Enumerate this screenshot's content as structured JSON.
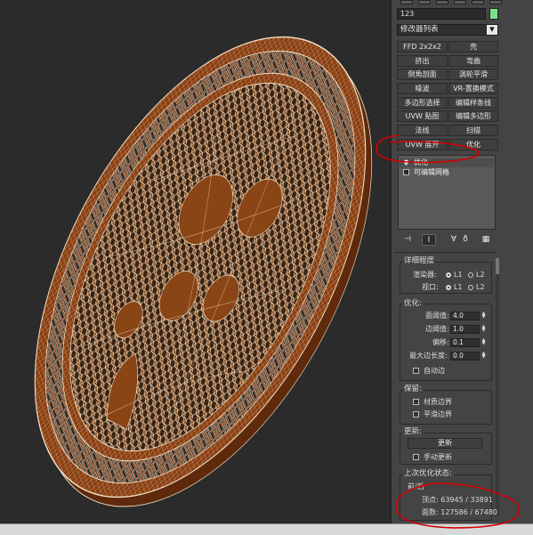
{
  "panel": {
    "object_name": "123",
    "object_color": "#7ee08a",
    "modifier_list_label": "修改器列表",
    "modifier_buttons": [
      [
        "FFD 2x2x2",
        "壳"
      ],
      [
        "挤出",
        "弯曲"
      ],
      [
        "倒角剖面",
        "涡轮平滑"
      ],
      [
        "噪波",
        "VR-置换模式"
      ],
      [
        "多边形选择",
        "编辑样条线"
      ],
      [
        "UVW 贴图",
        "编辑多边形"
      ],
      [
        "法线",
        "扫描"
      ],
      [
        "UVW 展开",
        "优化"
      ]
    ],
    "stack": [
      {
        "label": "优化",
        "icon": "lightbulb-icon",
        "selected": true
      },
      {
        "label": "可编辑网格",
        "icon": "mesh-icon",
        "selected": false
      }
    ],
    "stack_tools": [
      "pin-stack-icon",
      "show-end-result-icon",
      "make-unique-icon",
      "remove-modifier-icon",
      "configure-sets-icon"
    ]
  },
  "rollout": {
    "level_title": "详细程度",
    "renderer_label": "渲染器:",
    "viewport_label": "视口:",
    "l1": "L1",
    "l2": "L2",
    "optimize_title": "优化:",
    "face_threshold_label": "面阈值:",
    "face_threshold_value": "4.0",
    "edge_threshold_label": "边阈值:",
    "edge_threshold_value": "1.0",
    "bias_label": "偏移:",
    "bias_value": "0.1",
    "max_edge_label": "最大边长度:",
    "max_edge_value": "0.0",
    "auto_edge_label": "自动边",
    "preserve_title": "保留:",
    "material_boundary_label": "材质边界",
    "smooth_boundary_label": "平滑边界",
    "update_title": "更新:",
    "update_button": "更新",
    "manual_update_label": "手动更新",
    "last_status_title": "上次优化状态:",
    "before_after_label": "前/后",
    "vertices_label": "顶点: 63945 / 33891",
    "faces_label": "面数: 127586 / 67480"
  },
  "colors": {
    "wood": "#8a3f12",
    "wire": "#f4e3c8",
    "annotation": "#d40000"
  }
}
